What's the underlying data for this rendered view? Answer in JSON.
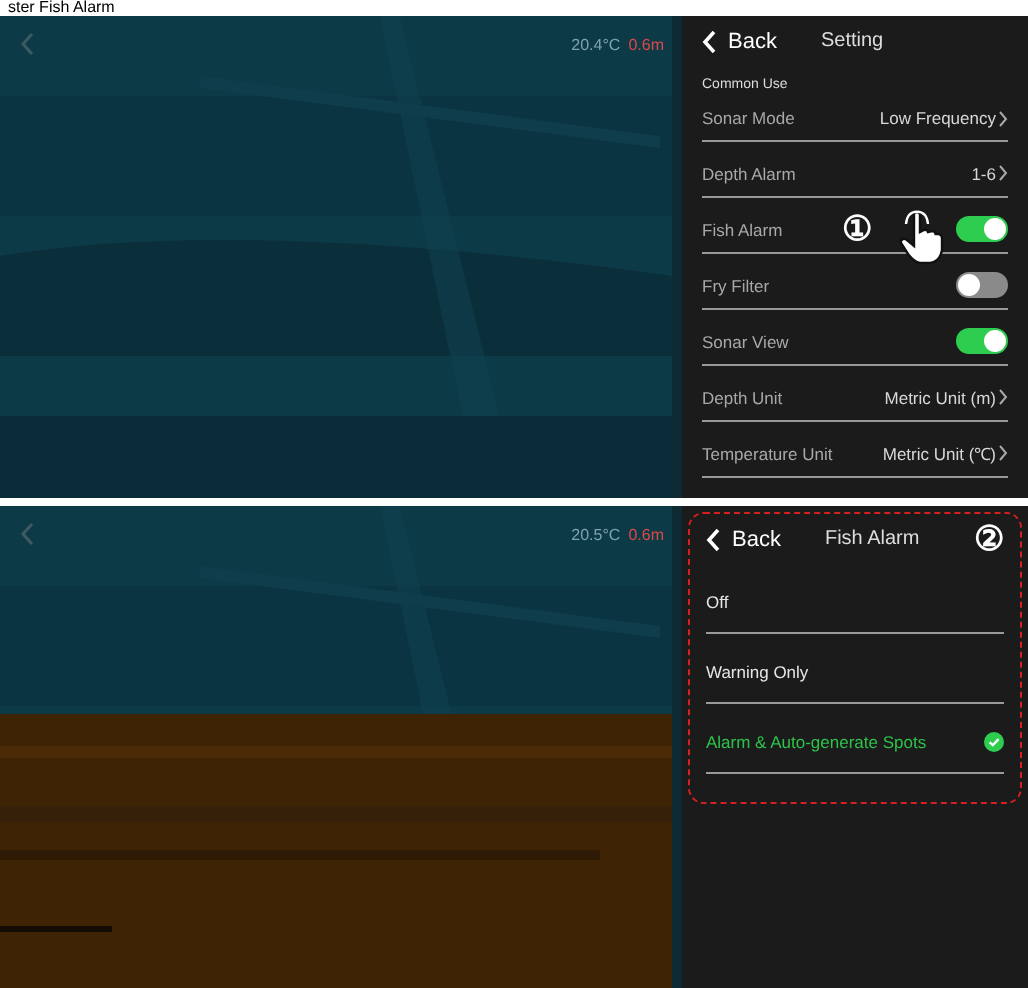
{
  "caption": "ster Fish Alarm",
  "screens": [
    {
      "sonar": {
        "readings": [
          "20.4°C",
          "0.6m"
        ],
        "bottom": false
      },
      "panel": {
        "back": "Back",
        "title": "Setting",
        "section": "Common Use",
        "step": "①",
        "pointer": true,
        "outlined": false,
        "rows": [
          {
            "kind": "value",
            "label": "Sonar Mode",
            "value": "Low Frequency"
          },
          {
            "kind": "value",
            "label": "Depth Alarm",
            "value": "1-6"
          },
          {
            "kind": "toggle",
            "label": "Fish Alarm",
            "on": true
          },
          {
            "kind": "toggle",
            "label": "Fry Filter",
            "on": false
          },
          {
            "kind": "toggle",
            "label": "Sonar View",
            "on": true
          },
          {
            "kind": "value",
            "label": "Depth Unit",
            "value": "Metric Unit (m)"
          },
          {
            "kind": "value",
            "label": "Temperature Unit",
            "value": "Metric Unit (℃)"
          }
        ]
      }
    },
    {
      "sonar": {
        "readings": [
          "20.5°C",
          "0.6m"
        ],
        "bottom": true
      },
      "panel": {
        "back": "Back",
        "title": "Fish Alarm",
        "step": "②",
        "pointer": false,
        "outlined": true,
        "rows": [
          {
            "kind": "option",
            "label": "Off",
            "selected": false
          },
          {
            "kind": "option",
            "label": "Warning Only",
            "selected": false
          },
          {
            "kind": "option",
            "label": "Alarm & Auto-generate Spots",
            "selected": true
          }
        ]
      }
    }
  ]
}
